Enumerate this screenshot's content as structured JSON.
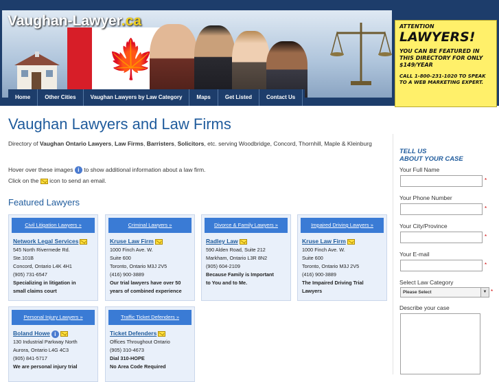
{
  "header": {
    "logo_main": "Vaughan-Lawyer",
    "logo_tld": ".ca"
  },
  "nav": [
    "Home",
    "Other Cities",
    "Vaughan Lawyers by Law Category",
    "Maps",
    "Get Listed",
    "Contact Us"
  ],
  "ad": {
    "line1": "ATTENTION",
    "line2": "LAWYERS!",
    "line3": "YOU CAN BE FEATURED IN THIS DIRECTORY FOR ONLY $149/YEAR",
    "line4": "CALL 1-800-231-1020 TO SPEAK TO A WEB MARKETING EXPERT."
  },
  "main": {
    "title": "Vaughan Lawyers and Law Firms",
    "intro_a": "Directory of ",
    "intro_b": "Vaughan Ontario Lawyers",
    "intro_c": ", ",
    "intro_d": "Law Firms",
    "intro_e": ", ",
    "intro_f": "Barristers",
    "intro_g": ", ",
    "intro_h": "Solicitors",
    "intro_i": ", etc. serving Woodbridge, Concord, Thornhill, Maple & Kleinburg",
    "hover_a": "Hover over these images ",
    "hover_b": " to show additional information about a law firm.",
    "click_a": "Click on the ",
    "click_b": " icon to send an email.",
    "featured_title": "Featured Lawyers"
  },
  "cards": [
    {
      "category": "Civil Litigation Lawyers »",
      "name": "Network Legal Services",
      "lines": [
        "545 North Rivermede Rd.",
        "Ste.101B",
        "Concord, Ontario L4K 4H1",
        "(905) 731-6547"
      ],
      "bold": [
        "Specializing in litigation in",
        "small claims court"
      ]
    },
    {
      "category": "Criminal Lawyers »",
      "name": "Kruse Law Firm",
      "lines": [
        "1000 Finch Ave. W.",
        "Suite 600",
        "Toronto, Ontario M3J 2V5",
        "(416) 900-3889"
      ],
      "bold": [
        "Our trial lawyers have over 50",
        "years of combined experience"
      ]
    },
    {
      "category": "Divorce & Family Lawyers »",
      "name": "Radley Law",
      "lines": [
        "590 Alden Road, Suite 212",
        "Markham, Ontario L3R 8N2",
        "(905) 604-2109"
      ],
      "bold": [
        "Because Family is Important",
        "to You and to Me."
      ]
    },
    {
      "category": "Impaired Driving Lawyers »",
      "name": "Kruse Law Firm",
      "lines": [
        "1000 Finch Ave. W.",
        "Suite 600",
        "Toronto, Ontario M3J 2V5",
        "(416) 900-3889"
      ],
      "bold": [
        "The Impaired Driving Trial",
        "Lawyers"
      ]
    },
    {
      "category": "Personal Injury Lawyers »",
      "name": "Boland Howe",
      "lines": [
        "130 Industrial Parkway North",
        "Aurora, Ontario L4G 4C3",
        "(905) 841-5717"
      ],
      "bold": [
        "We are personal injury trial"
      ]
    },
    {
      "category": "Traffic Ticket Defenders »",
      "name": "Ticket Defenders",
      "lines": [
        "Offices Throughout Ontario",
        "(905) 310-4673"
      ],
      "bold": [
        "Dial 310-HOPE",
        "No Area Code Required"
      ]
    }
  ],
  "form": {
    "tell1": "TELL US",
    "tell2": "ABOUT YOUR CASE",
    "name_label": "Your Full Name",
    "phone_label": "Your Phone Number",
    "city_label": "Your City/Province",
    "email_label": "Your E-mail",
    "category_label": "Select Law Category",
    "category_value": "Please Select",
    "describe_label": "Describe your case",
    "required_mark": "*"
  }
}
